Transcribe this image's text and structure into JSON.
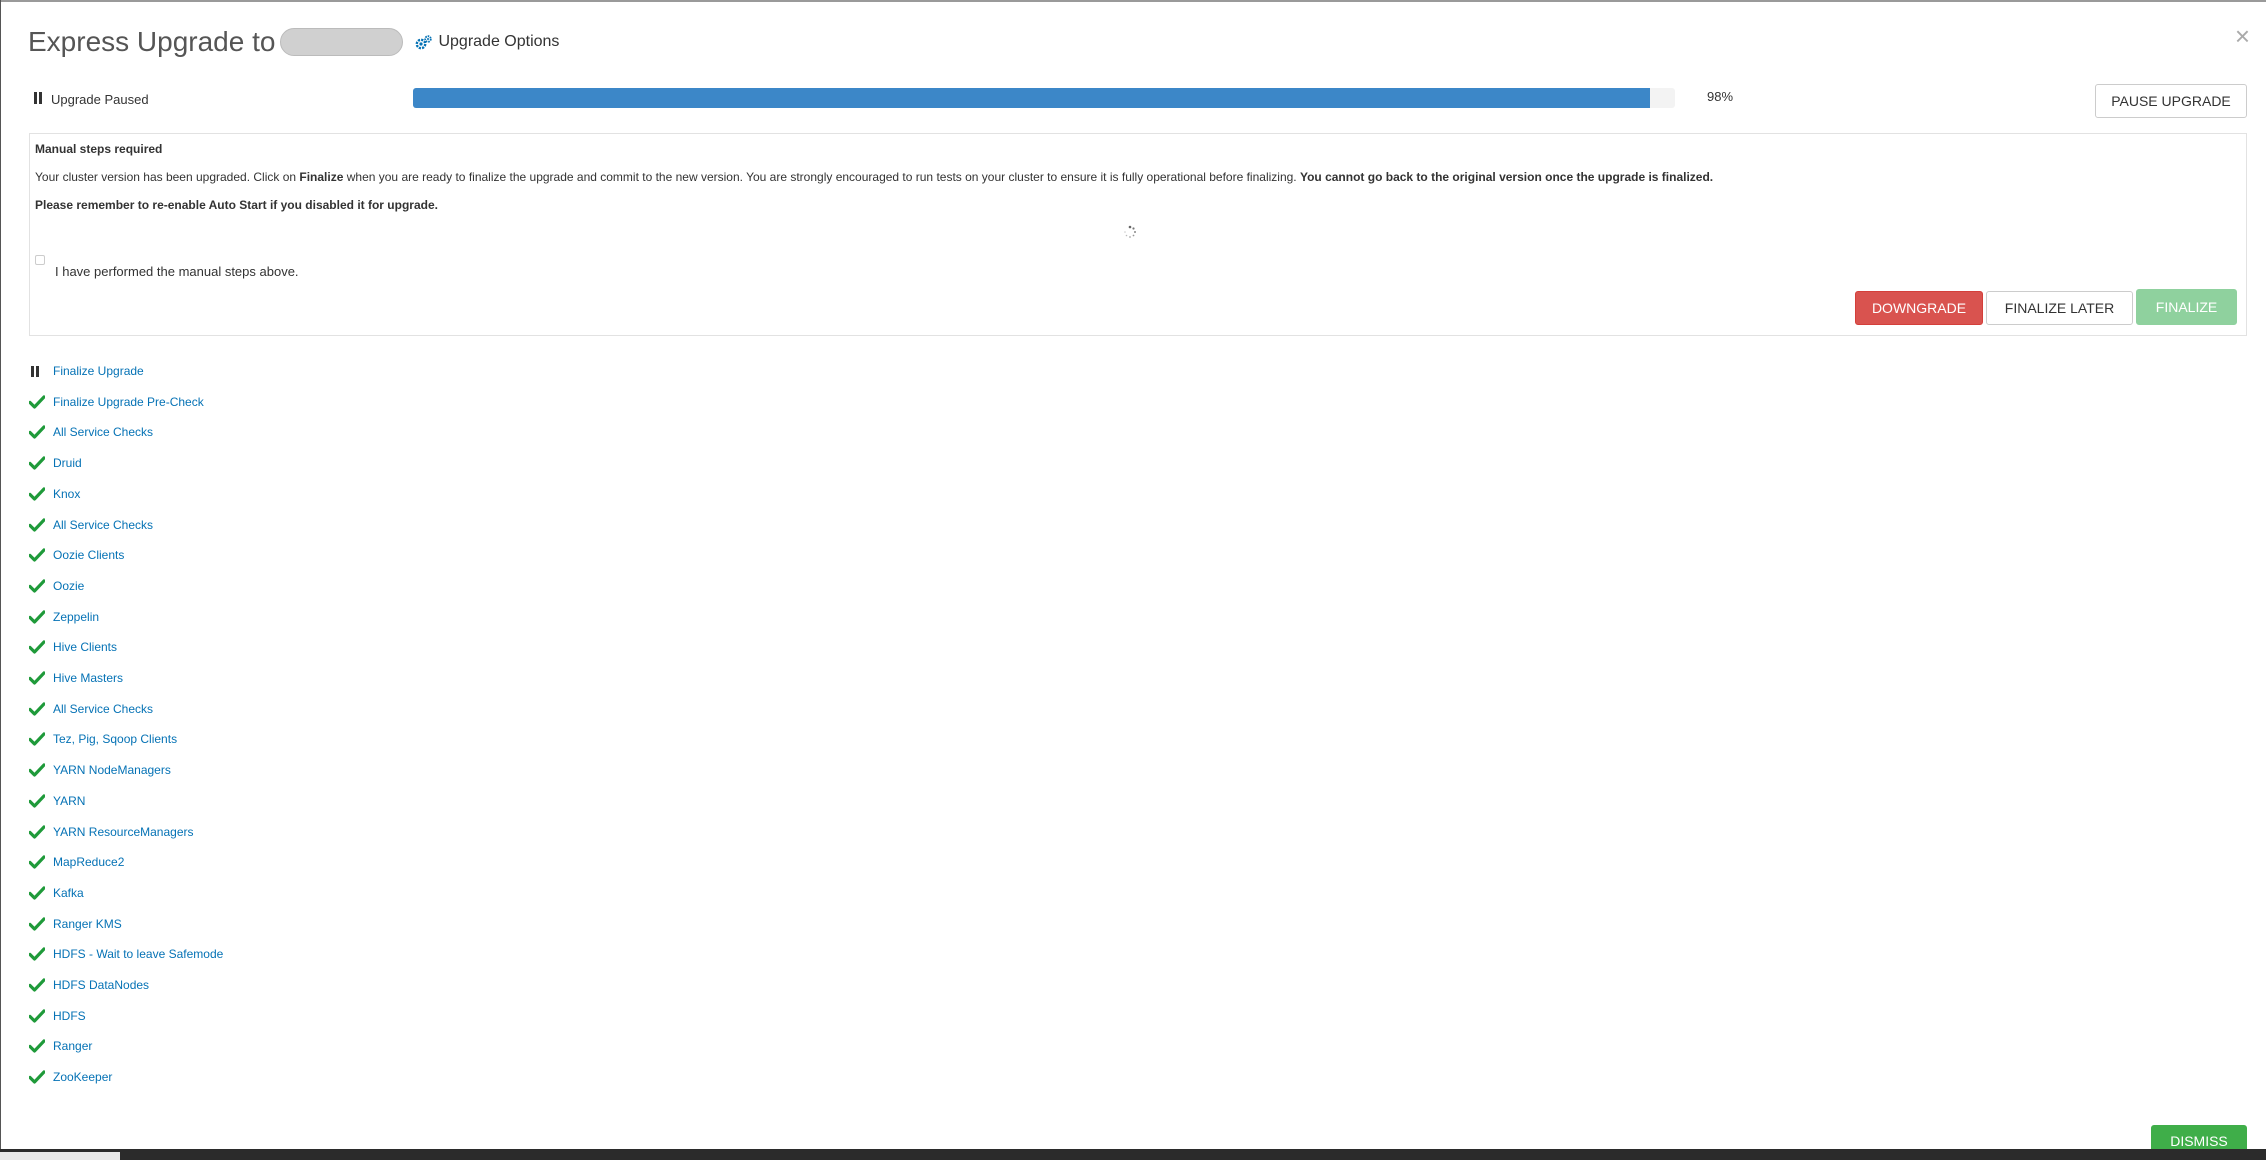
{
  "header": {
    "title": "Express Upgrade to",
    "options_label": "Upgrade Options",
    "close_glyph": "×"
  },
  "status": {
    "label": "Upgrade Paused",
    "progress": 0.98,
    "progress_text": "98%",
    "pause_button": "PAUSE UPGRADE"
  },
  "manual": {
    "title": "Manual steps required",
    "text_before": "Your cluster version has been upgraded. Click on ",
    "text_bold_finalize": "Finalize",
    "text_middle": " when you are ready to finalize the upgrade and commit to the new version. You are strongly encouraged to run tests on your cluster to ensure it is fully operational before finalizing. ",
    "text_bold_end": "You cannot go back to the original version once the upgrade is finalized.",
    "reminder": "Please remember to re-enable Auto Start if you disabled it for upgrade.",
    "checkbox_label": "I have performed the manual steps above.",
    "checked": false,
    "buttons": {
      "downgrade": "DOWNGRADE",
      "finalize_later": "FINALIZE LATER",
      "finalize": "FINALIZE"
    }
  },
  "tasks": [
    {
      "label": "Finalize Upgrade",
      "state": "paused"
    },
    {
      "label": "Finalize Upgrade Pre-Check",
      "state": "done"
    },
    {
      "label": "All Service Checks",
      "state": "done"
    },
    {
      "label": "Druid",
      "state": "done"
    },
    {
      "label": "Knox",
      "state": "done"
    },
    {
      "label": "All Service Checks",
      "state": "done"
    },
    {
      "label": "Oozie Clients",
      "state": "done"
    },
    {
      "label": "Oozie",
      "state": "done"
    },
    {
      "label": "Zeppelin",
      "state": "done"
    },
    {
      "label": "Hive Clients",
      "state": "done"
    },
    {
      "label": "Hive Masters",
      "state": "done"
    },
    {
      "label": "All Service Checks",
      "state": "done"
    },
    {
      "label": "Tez, Pig, Sqoop Clients",
      "state": "done"
    },
    {
      "label": "YARN NodeManagers",
      "state": "done"
    },
    {
      "label": "YARN",
      "state": "done"
    },
    {
      "label": "YARN ResourceManagers",
      "state": "done"
    },
    {
      "label": "MapReduce2",
      "state": "done"
    },
    {
      "label": "Kafka",
      "state": "done"
    },
    {
      "label": "Ranger KMS",
      "state": "done"
    },
    {
      "label": "HDFS - Wait to leave Safemode",
      "state": "done"
    },
    {
      "label": "HDFS DataNodes",
      "state": "done"
    },
    {
      "label": "HDFS",
      "state": "done"
    },
    {
      "label": "Ranger",
      "state": "done"
    },
    {
      "label": "ZooKeeper",
      "state": "done"
    }
  ],
  "footer": {
    "dismiss": "DISMISS"
  },
  "colors": {
    "accent_blue": "#3c87c8",
    "link": "#0572b5",
    "success": "#1f9a3a",
    "danger": "#d9534f"
  }
}
